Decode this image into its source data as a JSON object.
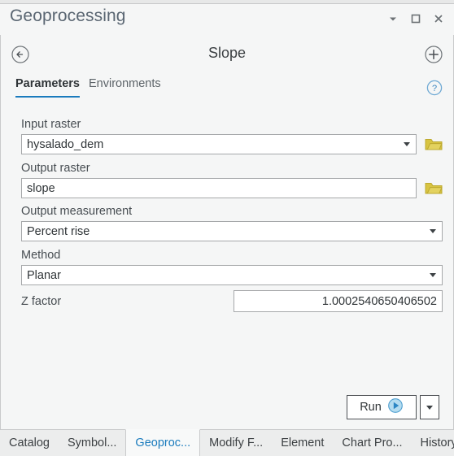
{
  "window": {
    "title": "Geoprocessing",
    "controls": [
      {
        "name": "menu-dropdown",
        "icon": "chevron-down-icon"
      },
      {
        "name": "maximize",
        "icon": "maximize-icon"
      },
      {
        "name": "close",
        "icon": "close-icon"
      }
    ]
  },
  "tool_header": {
    "back_icon": "circled-back-arrow-icon",
    "tool_name": "Slope",
    "add_icon": "circled-plus-icon"
  },
  "tabs": {
    "items": [
      {
        "label": "Parameters",
        "active": true
      },
      {
        "label": "Environments",
        "active": false
      }
    ],
    "help_icon": "circled-question-mark-icon"
  },
  "form": {
    "input_raster": {
      "label": "Input raster",
      "value": "hysalado_dem",
      "browse_icon": "open-folder-icon"
    },
    "output_raster": {
      "label": "Output raster",
      "value": "slope",
      "browse_icon": "open-folder-icon"
    },
    "output_measurement": {
      "label": "Output measurement",
      "value": "Percent rise"
    },
    "method": {
      "label": "Method",
      "value": "Planar"
    },
    "z_factor": {
      "label": "Z factor",
      "value": "1.0002540650406502"
    }
  },
  "actions": {
    "run_label": "Run",
    "run_icon": "blue-play-circle-icon",
    "run_dropdown_icon": "chevron-down-icon"
  },
  "dock_tabs": [
    {
      "label": "Catalog",
      "active": false
    },
    {
      "label": "Symbol...",
      "active": false
    },
    {
      "label": "Geoproc...",
      "active": true
    },
    {
      "label": "Modify F...",
      "active": false
    },
    {
      "label": "Element",
      "active": false
    },
    {
      "label": "Chart Pro...",
      "active": false
    },
    {
      "label": "History",
      "active": false
    }
  ],
  "colors": {
    "accent": "#1a7bbd",
    "panel_bg": "#f5f6f6",
    "folder": "#d8c442"
  }
}
